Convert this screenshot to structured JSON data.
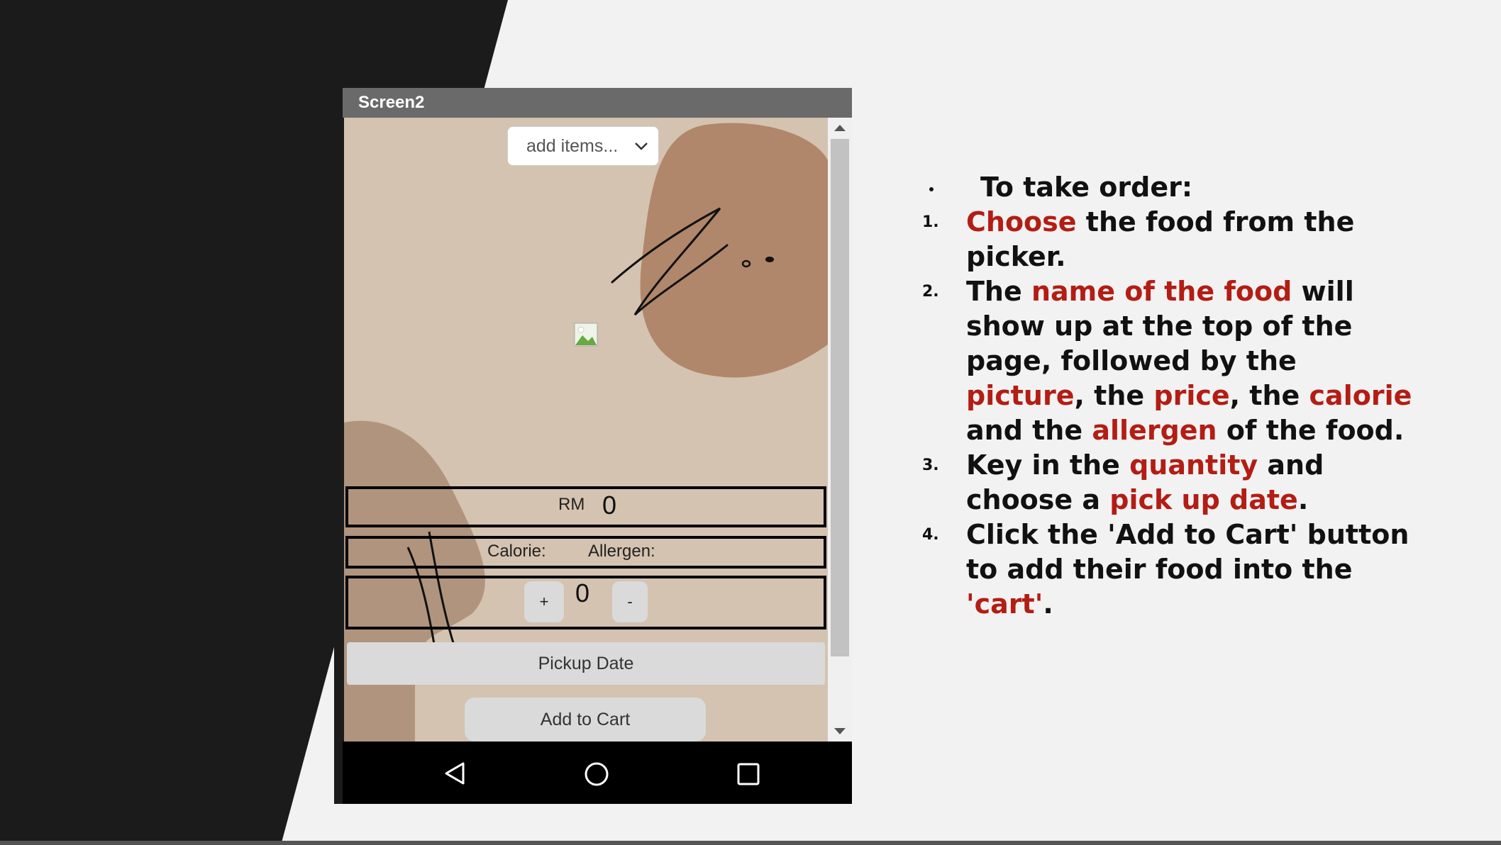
{
  "colors": {
    "slide_dark": "#1b1b1b",
    "slide_light": "#f2f2f2",
    "highlight_red": "#b31d14",
    "app_bg": "#d4c3b0",
    "blob_brown": "#b0876a"
  },
  "phone": {
    "title": "Screen2",
    "picker": {
      "selected": "add items...",
      "icon": "chevron-down-icon"
    },
    "image_placeholder_icon": "image-icon",
    "price": {
      "label": "RM",
      "value": "0"
    },
    "info": {
      "calorie_label": "Calorie:",
      "allergen_label": "Allergen:"
    },
    "quantity": {
      "plus": "+",
      "value": "0",
      "minus": "-"
    },
    "pickup_button": "Pickup Date",
    "cart_button": "Add to Cart",
    "nav_icons": [
      "back-triangle-icon",
      "home-circle-icon",
      "recent-square-icon"
    ]
  },
  "instructions": {
    "heading": "To take order:",
    "steps": [
      {
        "num": "1.",
        "parts": [
          {
            "text": "Choose",
            "red": true
          },
          {
            "text": " the food from the picker.",
            "red": false
          }
        ]
      },
      {
        "num": "2.",
        "parts": [
          {
            "text": "The ",
            "red": false
          },
          {
            "text": "name of the food",
            "red": true
          },
          {
            "text": " will show up at the top of the page, followed by the ",
            "red": false
          },
          {
            "text": "picture",
            "red": true
          },
          {
            "text": ", the ",
            "red": false
          },
          {
            "text": "price",
            "red": true
          },
          {
            "text": ", the ",
            "red": false
          },
          {
            "text": "calorie",
            "red": true
          },
          {
            "text": " and the ",
            "red": false
          },
          {
            "text": "allergen",
            "red": true
          },
          {
            "text": " of the food.",
            "red": false
          }
        ]
      },
      {
        "num": "3.",
        "parts": [
          {
            "text": "Key in the ",
            "red": false
          },
          {
            "text": "quantity",
            "red": true
          },
          {
            "text": " and choose a ",
            "red": false
          },
          {
            "text": "pick up date",
            "red": true
          },
          {
            "text": ".",
            "red": false
          }
        ]
      },
      {
        "num": "4.",
        "parts": [
          {
            "text": "Click the 'Add to Cart' button to add their food into the ",
            "red": false
          },
          {
            "text": "'cart'",
            "red": true
          },
          {
            "text": ".",
            "red": false
          }
        ]
      }
    ]
  }
}
